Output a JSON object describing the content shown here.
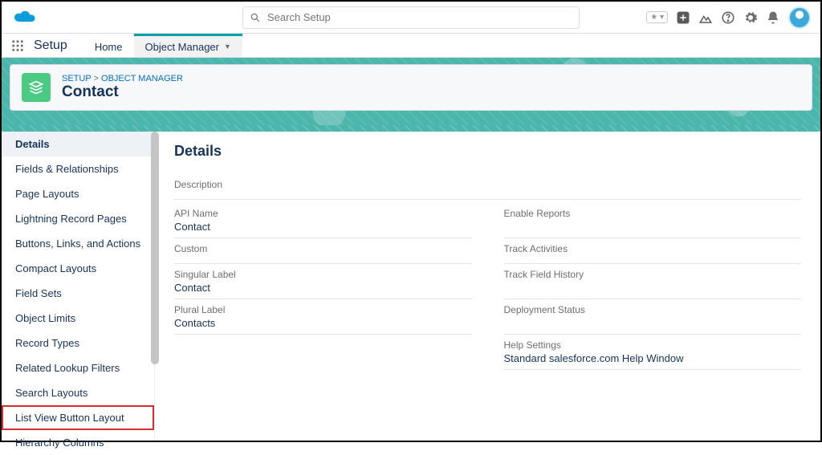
{
  "search": {
    "placeholder": "Search Setup"
  },
  "app": {
    "name": "Setup"
  },
  "nav": {
    "home": "Home",
    "objectManager": "Object Manager"
  },
  "breadcrumb": {
    "setup": "SETUP",
    "objectManager": "OBJECT MANAGER"
  },
  "object": {
    "title": "Contact"
  },
  "sidebar": {
    "items": [
      "Details",
      "Fields & Relationships",
      "Page Layouts",
      "Lightning Record Pages",
      "Buttons, Links, and Actions",
      "Compact Layouts",
      "Field Sets",
      "Object Limits",
      "Record Types",
      "Related Lookup Filters",
      "Search Layouts",
      "List View Button Layout",
      "Hierarchy Columns"
    ]
  },
  "content": {
    "heading": "Details",
    "rows": {
      "description": {
        "label": "Description",
        "value": ""
      },
      "apiName": {
        "label": "API Name",
        "value": "Contact"
      },
      "enableReports": {
        "label": "Enable Reports",
        "value": ""
      },
      "custom": {
        "label": "Custom",
        "value": ""
      },
      "trackActivities": {
        "label": "Track Activities",
        "value": ""
      },
      "singularLabel": {
        "label": "Singular Label",
        "value": "Contact"
      },
      "trackFieldHistory": {
        "label": "Track Field History",
        "value": ""
      },
      "pluralLabel": {
        "label": "Plural Label",
        "value": "Contacts"
      },
      "deploymentStatus": {
        "label": "Deployment Status",
        "value": ""
      },
      "helpSettings": {
        "label": "Help Settings",
        "value": "Standard salesforce.com Help Window"
      }
    }
  }
}
